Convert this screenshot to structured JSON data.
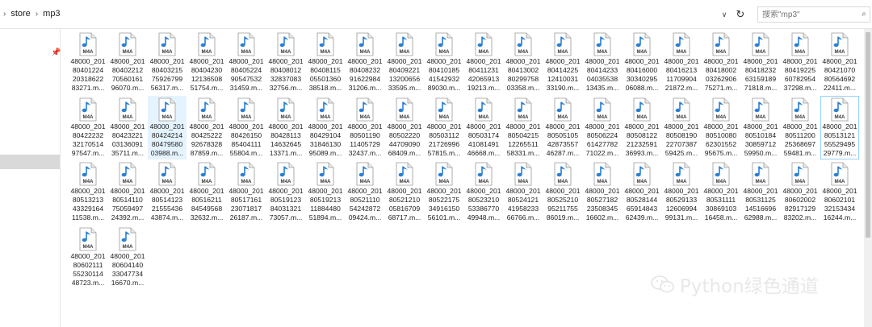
{
  "address_bar": {
    "breadcrumbs": [
      "store",
      "mp3"
    ],
    "search_placeholder": "搜索\"mp3\""
  },
  "icons": {
    "folder_nav": "chevron-right-icon",
    "dropdown": "chevron-down-icon",
    "refresh": "refresh-icon",
    "search": "search-icon",
    "pin": "pin-icon",
    "file": "m4a-file-icon"
  },
  "file_icon_label": "M4A",
  "colors": {
    "file_icon_blue": "#2a7fd4",
    "selection": "#e5f3ff",
    "focus_border": "#99d1ff"
  },
  "files": [
    [
      "48000_201",
      "80401224",
      "20318622",
      "83271.m..."
    ],
    [
      "48000_201",
      "80402212",
      "70560161",
      "96070.m..."
    ],
    [
      "48000_201",
      "80403215",
      "75926799",
      "56317.m..."
    ],
    [
      "48000_201",
      "80404230",
      "12136508",
      "51754.m..."
    ],
    [
      "48000_201",
      "80405224",
      "90547532",
      "31459.m..."
    ],
    [
      "48000_201",
      "80408012",
      "32837083",
      "32756.m..."
    ],
    [
      "48000_201",
      "80408115",
      "05501360",
      "38518.m..."
    ],
    [
      "48000_201",
      "80408232",
      "91622984",
      "31206.m..."
    ],
    [
      "48000_201",
      "80409221",
      "13200656",
      "33595.m..."
    ],
    [
      "48000_201",
      "80410185",
      "41542932",
      "89030.m..."
    ],
    [
      "48000_201",
      "80411231",
      "42065913",
      "19213.m..."
    ],
    [
      "48000_201",
      "80413002",
      "80299758",
      "03358.m..."
    ],
    [
      "48000_201",
      "80414225",
      "12410031",
      "33190.m..."
    ],
    [
      "48000_201",
      "80414233",
      "04035538",
      "13435.m..."
    ],
    [
      "48000_201",
      "80416000",
      "30340295",
      "06088.m..."
    ],
    [
      "48000_201",
      "80416213",
      "11709904",
      "21872.m..."
    ],
    [
      "48000_201",
      "80418002",
      "03262906",
      "75271.m..."
    ],
    [
      "48000_201",
      "80418232",
      "63159189",
      "71818.m..."
    ],
    [
      "48000_201",
      "80419225",
      "60782954",
      "37298.m..."
    ],
    [
      "48000_201",
      "80421070",
      "80564692",
      "22411.m..."
    ],
    [
      "48000_201",
      "80422232",
      "32170514",
      "97547.m..."
    ],
    [
      "48000_201",
      "80423221",
      "03136091",
      "35711.m..."
    ],
    [
      "48000_201",
      "80424214",
      "80479580",
      "03988.m..."
    ],
    [
      "48000_201",
      "80425222",
      "92678328",
      "87859.m..."
    ],
    [
      "48000_201",
      "80426150",
      "85404111",
      "55804.m..."
    ],
    [
      "48000_201",
      "80428113",
      "14632645",
      "13371.m..."
    ],
    [
      "48000_201",
      "80429104",
      "31846130",
      "95089.m..."
    ],
    [
      "48000_201",
      "80501190",
      "11405729",
      "32437.m..."
    ],
    [
      "48000_201",
      "80502220",
      "44709090",
      "68409.m..."
    ],
    [
      "48000_201",
      "80503112",
      "21726996",
      "57815.m..."
    ],
    [
      "48000_201",
      "80503174",
      "41081491",
      "46668.m..."
    ],
    [
      "48000_201",
      "80504215",
      "12265511",
      "58331.m..."
    ],
    [
      "48000_201",
      "80505105",
      "42873557",
      "46287.m..."
    ],
    [
      "48000_201",
      "80506224",
      "61427782",
      "71022.m..."
    ],
    [
      "48000_201",
      "80508122",
      "21232591",
      "36993.m..."
    ],
    [
      "48000_201",
      "80508190",
      "22707387",
      "59425.m..."
    ],
    [
      "48000_201",
      "80510080",
      "62301552",
      "95675.m..."
    ],
    [
      "48000_201",
      "80510184",
      "30859712",
      "59950.m..."
    ],
    [
      "48000_201",
      "80511200",
      "25368697",
      "59481.m..."
    ],
    [
      "48000_201",
      "80513121",
      "55529495",
      "29779.m..."
    ],
    [
      "48000_201",
      "80513213",
      "43329164",
      "11538.m..."
    ],
    [
      "48000_201",
      "80514110",
      "75059497",
      "24392.m..."
    ],
    [
      "48000_201",
      "80514123",
      "21555436",
      "43874.m..."
    ],
    [
      "48000_201",
      "80516211",
      "84549568",
      "32632.m..."
    ],
    [
      "48000_201",
      "80517161",
      "23071817",
      "26187.m..."
    ],
    [
      "48000_201",
      "80519123",
      "84031321",
      "73057.m..."
    ],
    [
      "48000_201",
      "80519213",
      "11884480",
      "51894.m..."
    ],
    [
      "48000_201",
      "80521110",
      "54242872",
      "09424.m..."
    ],
    [
      "48000_201",
      "80521210",
      "05816709",
      "68717.m..."
    ],
    [
      "48000_201",
      "80522175",
      "34916150",
      "56101.m..."
    ],
    [
      "48000_201",
      "80523210",
      "53386770",
      "49948.m..."
    ],
    [
      "48000_201",
      "80524121",
      "41958233",
      "66766.m..."
    ],
    [
      "48000_201",
      "80525210",
      "95211755",
      "86019.m..."
    ],
    [
      "48000_201",
      "80527182",
      "23508345",
      "16602.m..."
    ],
    [
      "48000_201",
      "80528144",
      "65914843",
      "62439.m..."
    ],
    [
      "48000_201",
      "80529133",
      "12606994",
      "99131.m..."
    ],
    [
      "48000_201",
      "80531111",
      "30869103",
      "16458.m..."
    ],
    [
      "48000_201",
      "80531125",
      "14516696",
      "62988.m..."
    ],
    [
      "48000_201",
      "80602002",
      "82917129",
      "83202.m..."
    ],
    [
      "48000_201",
      "80602101",
      "32153434",
      "16244.m..."
    ],
    [
      "48000_201",
      "80602111",
      "55230114",
      "48723.m..."
    ],
    [
      "48000_201",
      "80604140",
      "33047734",
      "16670.m..."
    ]
  ],
  "selected_index": 22,
  "focused_index": 39,
  "watermark": {
    "text": "Python绿色通道",
    "icon": "wechat-icon"
  }
}
